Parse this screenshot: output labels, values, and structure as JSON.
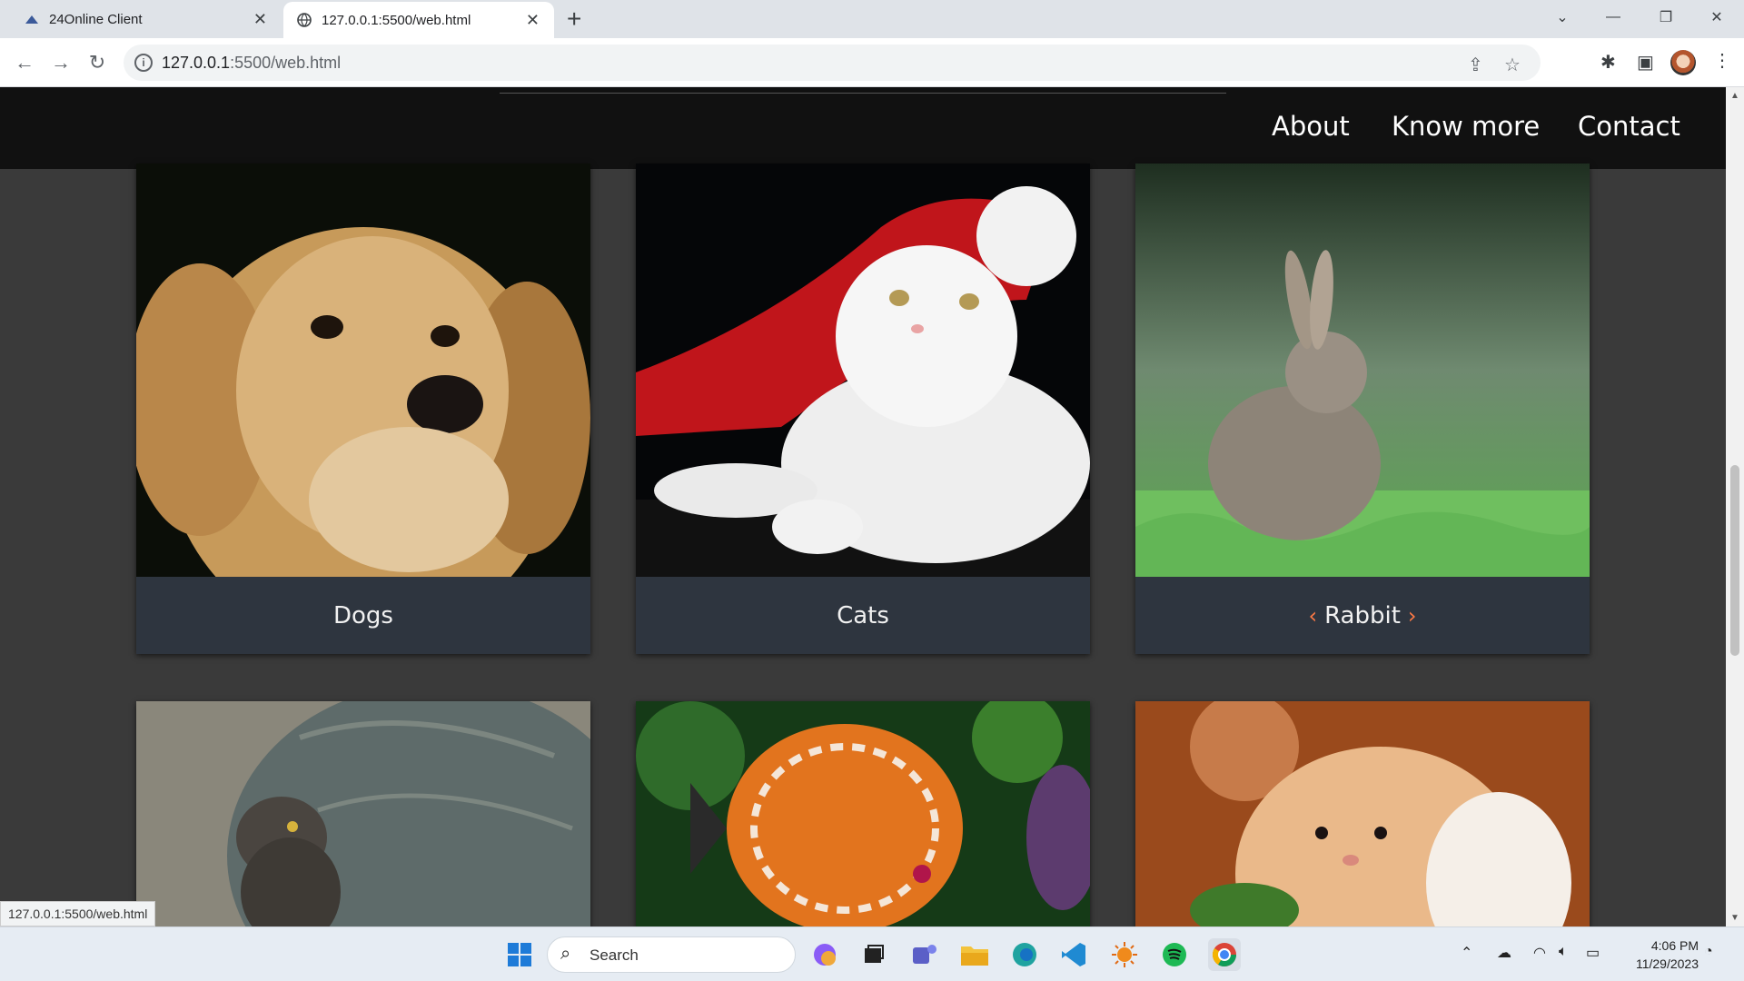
{
  "browser": {
    "tabs": [
      {
        "label": "24Online Client"
      },
      {
        "label": "127.0.0.1:5500/web.html"
      }
    ],
    "url_host": "127.0.0.1",
    "url_rest": ":5500/web.html",
    "status_url": "127.0.0.1:5500/web.html"
  },
  "site": {
    "nav": [
      "About",
      "Know more",
      "Contact"
    ]
  },
  "cards": [
    {
      "caption": "Dogs"
    },
    {
      "caption": "Cats"
    },
    {
      "caption": "Rabbit",
      "left_chevron": "‹",
      "right_chevron": "›"
    },
    {
      "caption": ""
    },
    {
      "caption": ""
    },
    {
      "caption": ""
    }
  ],
  "taskbar": {
    "search_label": "Search",
    "time": "4:06 PM",
    "date": "11/29/2023"
  },
  "colors": {
    "accent": "#ff7a45",
    "card_caption_bg": "#2e353f",
    "header_bg": "#111111",
    "page_bg": "#3a3a3a"
  }
}
